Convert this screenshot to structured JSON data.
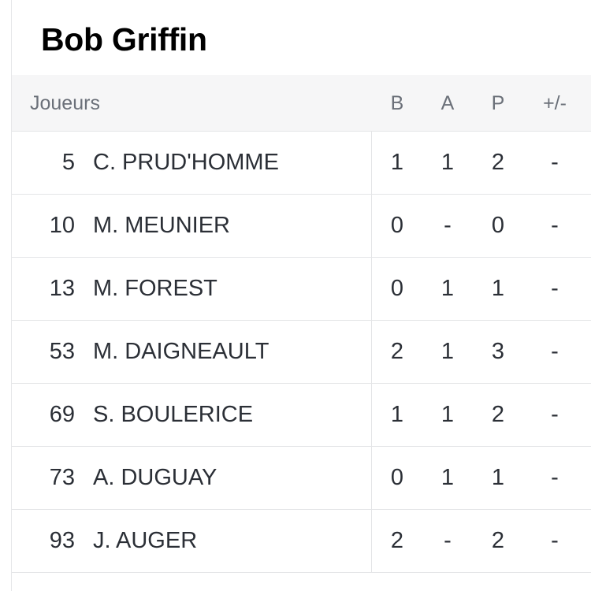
{
  "team": {
    "title": "Bob Griffin"
  },
  "table": {
    "headers": {
      "players": "Joueurs",
      "goals": "B",
      "assists": "A",
      "points": "P",
      "plus_minus": "+/-"
    },
    "rows": [
      {
        "number": "5",
        "name": "C. PRUD'HOMME",
        "goals": "1",
        "assists": "1",
        "points": "2",
        "plus_minus": "-"
      },
      {
        "number": "10",
        "name": "M. MEUNIER",
        "goals": "0",
        "assists": "-",
        "points": "0",
        "plus_minus": "-"
      },
      {
        "number": "13",
        "name": "M. FOREST",
        "goals": "0",
        "assists": "1",
        "points": "1",
        "plus_minus": "-"
      },
      {
        "number": "53",
        "name": "M. DAIGNEAULT",
        "goals": "2",
        "assists": "1",
        "points": "3",
        "plus_minus": "-"
      },
      {
        "number": "69",
        "name": "S. BOULERICE",
        "goals": "1",
        "assists": "1",
        "points": "2",
        "plus_minus": "-"
      },
      {
        "number": "73",
        "name": "A. DUGUAY",
        "goals": "0",
        "assists": "1",
        "points": "1",
        "plus_minus": "-"
      },
      {
        "number": "93",
        "name": "J. AUGER",
        "goals": "2",
        "assists": "-",
        "points": "2",
        "plus_minus": "-"
      }
    ]
  }
}
